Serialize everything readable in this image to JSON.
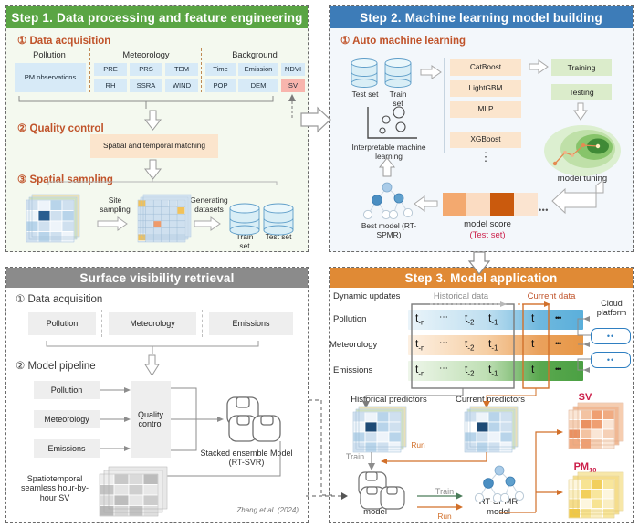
{
  "step1": {
    "header": "Step 1. Data processing and feature engineering",
    "header_color": "#5aa544",
    "s1_title": "① Data acquisition",
    "groups": [
      {
        "label": "Pollution",
        "cells": [
          [
            "PM observations"
          ]
        ]
      },
      {
        "label": "Meteorology",
        "cells": [
          [
            "PRE",
            "PRS",
            "TEM"
          ],
          [
            "RH",
            "SSRA",
            "WIND"
          ]
        ]
      },
      {
        "label": "Background",
        "cells": [
          [
            "Time",
            "Emission",
            "NDVI"
          ],
          [
            "POP",
            "DEM",
            "SV"
          ]
        ]
      }
    ],
    "s2_title": "② Quality control",
    "quality_box": "Spatial and temporal matching",
    "s3_title": "③ Spatial sampling",
    "site_sampling": "Site sampling",
    "generating": "Generating datasets",
    "train_set": "Train set",
    "test_set": "Test set"
  },
  "step2": {
    "header": "Step 2. Machine learning model building",
    "header_color": "#3d7cb8",
    "s1_title": "① Auto machine learning",
    "test_set": "Test set",
    "train_set": "Train set",
    "models": [
      "CatBoost",
      "LightGBM",
      "MLP",
      "XGBoost"
    ],
    "ellipsis": "⋮",
    "training": "Training",
    "testing": "Testing",
    "model_tuning": "model tuning",
    "model_score": "model score",
    "test_set_note": "(Test set)",
    "score_dots": "• • •",
    "interpretable": "Interpretable machine learning",
    "best_model": "Best model (RT-SPMR)"
  },
  "svr": {
    "header": "Surface visibility retrieval",
    "header_color": "#8b8b8b",
    "s1_title": "① Data acquisition",
    "sources": [
      "Pollution",
      "Meteorology",
      "Emissions"
    ],
    "s2_title": "② Model pipeline",
    "inputs": [
      "Pollution",
      "Meteorology",
      "Emissions"
    ],
    "quality_control": "Quality control",
    "stacked": "Stacked ensemble Model (RT-SVR)",
    "output": "Spatiotemporal seamless hour-by-hour SV",
    "citation": "Zhang et al. (2024)"
  },
  "step3": {
    "header": "Step 3. Model application",
    "header_color": "#e08a35",
    "dynamic_updates": "Dynamic updates",
    "historical_data": "Historical data",
    "current_data": "Current data",
    "rows": [
      {
        "name": "Pollution",
        "color": "#6fb8de"
      },
      {
        "name": "Meteorology",
        "color": "#eaa15c"
      },
      {
        "name": "Emissions",
        "color": "#5aa84f"
      }
    ],
    "time_cells": [
      "t",
      "⋯",
      "t",
      "t"
    ],
    "t_sub": [
      "-n",
      "",
      "-2",
      "-1"
    ],
    "current_t": "t",
    "row_dots": "•••",
    "cloud_platform": "Cloud platform",
    "cloud_dots": "••",
    "hist_predictors": "Historical predictors",
    "curr_predictors": "Current predictors",
    "train": "Train",
    "run": "Run",
    "rtsvr": "RT-SVR model",
    "rtspmr": "RT-SPMR model",
    "sv_label": "SV",
    "pm_label": "PM",
    "pm_sub": "10"
  }
}
